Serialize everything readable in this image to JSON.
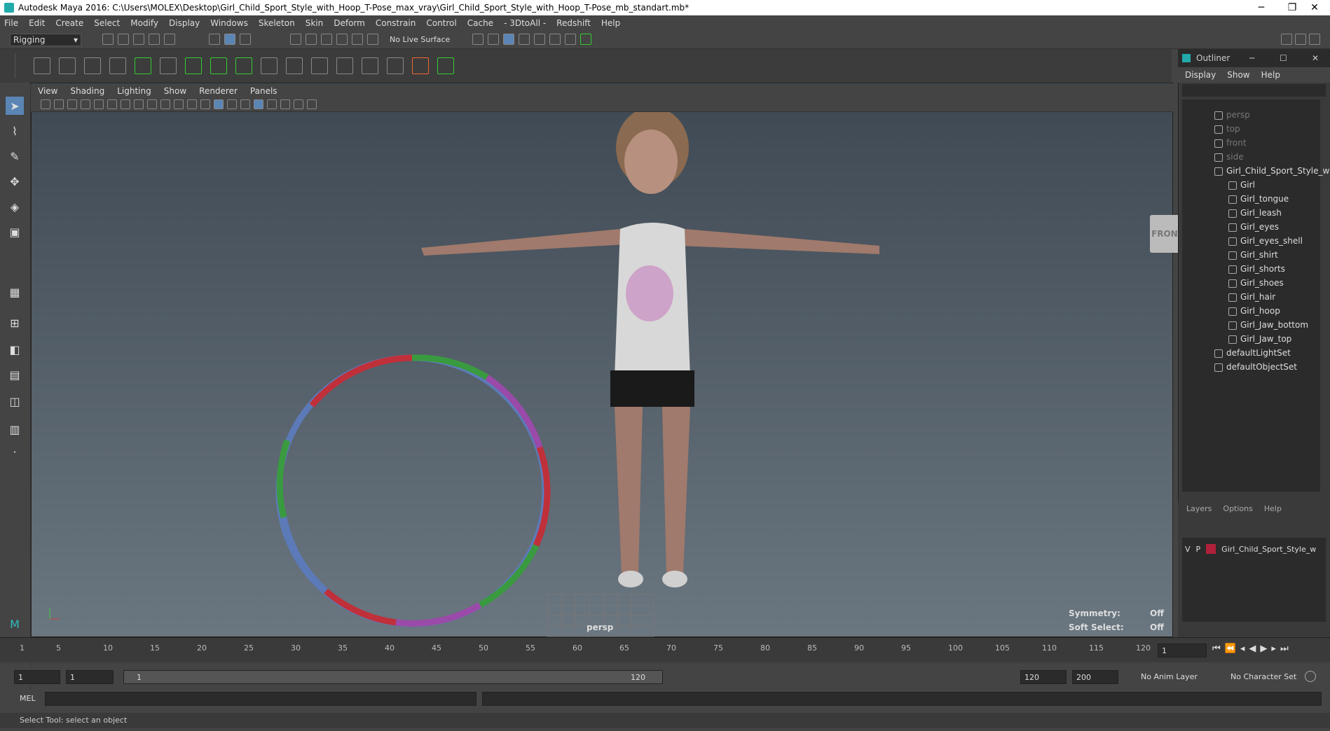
{
  "window": {
    "title": "Autodesk Maya 2016: C:\\Users\\MOLEX\\Desktop\\Girl_Child_Sport_Style_with_Hoop_T-Pose_max_vray\\Girl_Child_Sport_Style_with_Hoop_T-Pose_mb_standart.mb*"
  },
  "menu": [
    "File",
    "Edit",
    "Create",
    "Select",
    "Modify",
    "Display",
    "Windows",
    "Skeleton",
    "Skin",
    "Deform",
    "Constrain",
    "Control",
    "Cache",
    "- 3DtoAll -",
    "Redshift",
    "Help"
  ],
  "status_line": {
    "mode": "Rigging",
    "live_surface": "No Live Surface"
  },
  "viewport": {
    "menu": [
      "View",
      "Shading",
      "Lighting",
      "Show",
      "Renderer",
      "Panels"
    ],
    "camera": "persp",
    "viewcube": "FRONT",
    "symmetry_label": "Symmetry:",
    "symmetry_value": "Off",
    "soft_select_label": "Soft Select:",
    "soft_select_value": "Off"
  },
  "outliner": {
    "title": "Outliner",
    "menu": [
      "Display",
      "Show",
      "Help"
    ],
    "items": [
      {
        "label": "persp",
        "dim": true
      },
      {
        "label": "top",
        "dim": true
      },
      {
        "label": "front",
        "dim": true
      },
      {
        "label": "side",
        "dim": true
      },
      {
        "label": "Girl_Child_Sport_Style_with",
        "dim": false
      },
      {
        "label": "Girl"
      },
      {
        "label": "Girl_tongue"
      },
      {
        "label": "Girl_leash"
      },
      {
        "label": "Girl_eyes"
      },
      {
        "label": "Girl_eyes_shell"
      },
      {
        "label": "Girl_shirt"
      },
      {
        "label": "Girl_shorts"
      },
      {
        "label": "Girl_shoes"
      },
      {
        "label": "Girl_hair"
      },
      {
        "label": "Girl_hoop"
      },
      {
        "label": "Girl_Jaw_bottom"
      },
      {
        "label": "Girl_Jaw_top"
      },
      {
        "label": "defaultLightSet"
      },
      {
        "label": "defaultObjectSet"
      }
    ]
  },
  "layers": {
    "menu": [
      "Layers",
      "Options",
      "Help"
    ],
    "layer_v": "V",
    "layer_p": "P",
    "layer_name": "Girl_Child_Sport_Style_w",
    "layer_color": "#b0203a"
  },
  "timeline": {
    "ticks": [
      "5",
      "10",
      "15",
      "20",
      "25",
      "30",
      "35",
      "40",
      "45",
      "50",
      "55",
      "60",
      "65",
      "70",
      "75",
      "80",
      "85",
      "90",
      "95",
      "100",
      "105",
      "110",
      "115",
      "120"
    ],
    "start_tick": "1",
    "current_frame": "1"
  },
  "range": {
    "start": "1",
    "playback_start": "1",
    "slider_start": "1",
    "slider_end": "120",
    "playback_end": "120",
    "end": "200",
    "anim_layer": "No Anim Layer",
    "char_set": "No Character Set"
  },
  "cmd": {
    "label": "MEL"
  },
  "help": {
    "text": "Select Tool: select an object"
  }
}
